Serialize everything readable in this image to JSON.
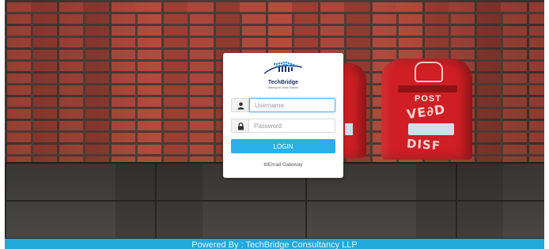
{
  "login_card": {
    "logo_alt": "TechBridge logo",
    "brand_name": "TechBridge",
    "tagline": "Making the world Smarter",
    "username": {
      "value": "",
      "placeholder": "Username",
      "icon": "user-icon"
    },
    "password": {
      "value": "",
      "placeholder": "Password",
      "icon": "lock-icon"
    },
    "login_label": "LOGIN",
    "gateway_label": "tbEmail Gateway"
  },
  "background": {
    "postbox_word": "POST",
    "scribble_top": "VE∂D",
    "scribble_bottom": "DISF"
  },
  "footer": {
    "text": "Powered By : TechBridge Consultancy LLP"
  },
  "colors": {
    "accent": "#29b0e6",
    "footer": "#22a9dc",
    "brand_text": "#1f2f6a",
    "postbox_red": "#cf1f24"
  }
}
